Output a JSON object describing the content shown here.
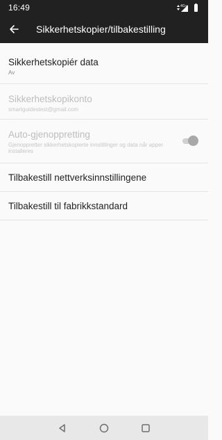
{
  "status_bar": {
    "time": "16:49",
    "network_label": "4G+"
  },
  "app_bar": {
    "title": "Sikkerhetskopier/tilbakestilling",
    "back_icon": "arrow-left-icon"
  },
  "settings": {
    "backup": {
      "title": "Sikkerhetskopiér data",
      "subtitle": "Av"
    },
    "account": {
      "title": "Sikkerhetskopikonto",
      "subtitle": "smartguidestest@gmail.com",
      "enabled": false
    },
    "auto_restore": {
      "title": "Auto-gjenoppretting",
      "subtitle": "Gjenoppretter sikkerhetskopierte innstillinger og data når apper installeres",
      "enabled": false,
      "toggle_on": true
    },
    "network_reset": {
      "title": "Tilbakestill nettverksinnstillingene"
    },
    "factory_reset": {
      "title": "Tilbakestill til fabrikkstandard"
    }
  },
  "nav_bar": {
    "back_icon": "triangle-back-icon",
    "home_icon": "circle-home-icon",
    "recent_icon": "square-recents-icon"
  },
  "colors": {
    "app_bar": "#212121",
    "background": "#fafafa",
    "divider": "#e3e3e3",
    "nav_bar": "#e8e8e8"
  }
}
